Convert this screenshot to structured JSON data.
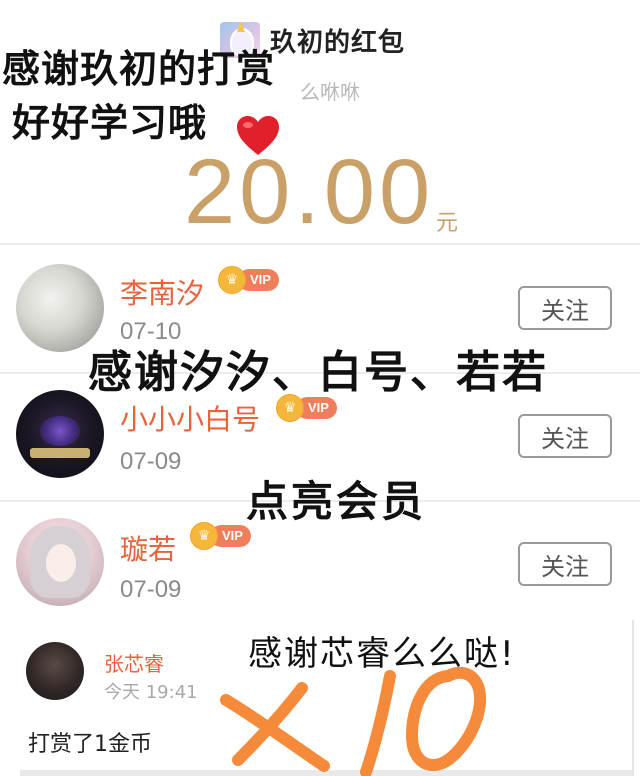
{
  "header": {
    "title": "玖初的红包",
    "subtitle": "么咻咻",
    "amount": "20.00",
    "unit": "元"
  },
  "overlays": {
    "line1": "感谢玖初的打赏",
    "line2": "好好学习哦",
    "line3": "感谢汐汐、白号、若若",
    "line4": "点亮会员",
    "line5": "感谢芯睿么么哒!"
  },
  "vip_label": "VIP",
  "follow_label": "关注",
  "rows": [
    {
      "name": "李南汐",
      "date": "07-10",
      "vip": true
    },
    {
      "name": "小小小白号",
      "date": "07-09",
      "vip": true
    },
    {
      "name": "璇若",
      "date": "07-09",
      "vip": true
    }
  ],
  "last_item": {
    "name": "张芯睿",
    "time": "今天 19:41",
    "tip": "打赏了1金币"
  },
  "colors": {
    "amount": "#c9a168",
    "name": "#e8623a",
    "vip_badge": "#f07e5b",
    "crown": "#f5b63c",
    "scribble": "#f58a3a",
    "heart": "#e0202a"
  },
  "icons": [
    "unicorn-avatar-icon",
    "heart-icon",
    "crown-icon"
  ]
}
